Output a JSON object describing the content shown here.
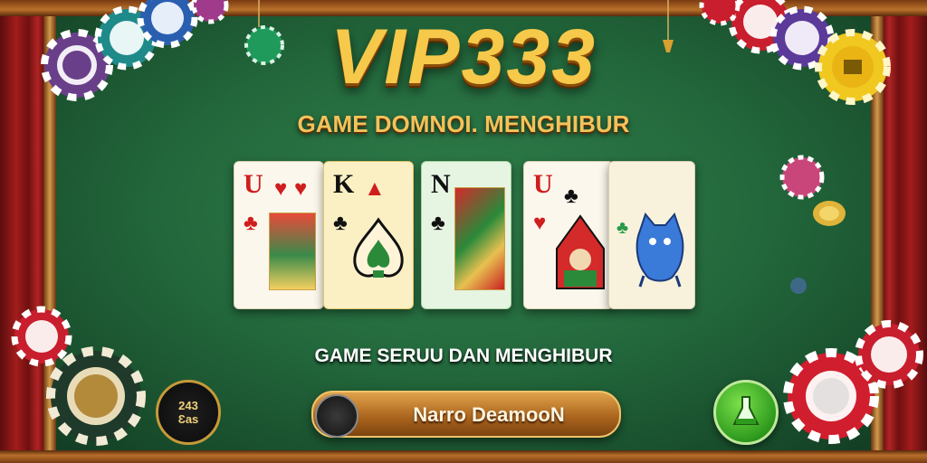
{
  "title": "VIP333",
  "subtitle": "GAME DOMNOI. MENGHIBUR",
  "tagline": "GAME SERUU DAN MENGHIBUR",
  "name_bar": {
    "label": "Narro DeamooN"
  },
  "badge": {
    "line1": "243",
    "line2": "Ɛas"
  },
  "cards": [
    {
      "rank": "U",
      "suits": [
        "♥",
        "♥",
        "♣"
      ],
      "color": "red"
    },
    {
      "rank": "K",
      "suits": [
        "▲",
        "♣"
      ],
      "color": "black"
    },
    {
      "rank": "N",
      "suits": [
        "♣"
      ],
      "color": "black"
    },
    {
      "rank": "U",
      "suits": [
        "♣",
        "♥"
      ],
      "color": "red"
    },
    {
      "rank": "",
      "suits": [
        "♣"
      ],
      "color": "black"
    }
  ],
  "colors": {
    "felt": "#23683c",
    "gold": "#f6c94a",
    "curtain": "#a41c1c",
    "frame": "#b8702a"
  }
}
